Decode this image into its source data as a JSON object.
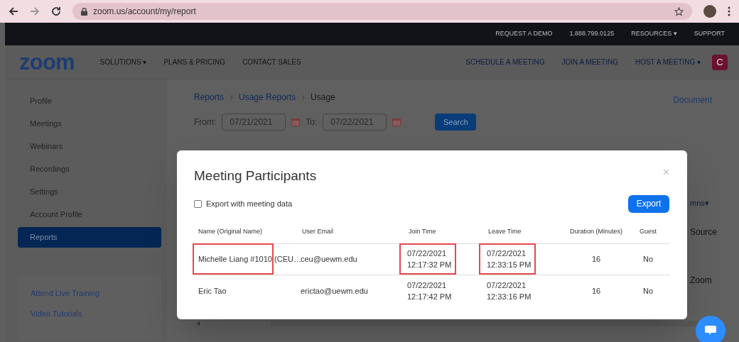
{
  "browser": {
    "url": "zoom.us/account/my/report"
  },
  "top_bar": {
    "links": [
      "REQUEST A DEMO",
      "1.888.799.0125",
      "RESOURCES ▾",
      "SUPPORT"
    ]
  },
  "nav": {
    "logo": "zoom",
    "left_links": [
      "SOLUTIONS ▾",
      "PLANS & PRICING",
      "CONTACT SALES"
    ],
    "right_links": [
      "SCHEDULE A MEETING",
      "JOIN A MEETING",
      "HOST A MEETING ▾"
    ],
    "avatar": "C"
  },
  "sidebar": {
    "items": [
      {
        "label": "Profile",
        "selected": false
      },
      {
        "label": "Meetings",
        "selected": false
      },
      {
        "label": "Webinars",
        "selected": false
      },
      {
        "label": "Recordings",
        "selected": false
      },
      {
        "label": "Settings",
        "selected": false
      },
      {
        "label": "Account Profile",
        "selected": false
      },
      {
        "label": "Reports",
        "selected": true
      }
    ],
    "help_links": [
      "Attend Live Training",
      "Video Tutorials"
    ]
  },
  "breadcrumb": [
    {
      "label": "Reports",
      "link": true
    },
    {
      "label": "Usage Reports",
      "link": true
    },
    {
      "label": "Usage",
      "link": false
    }
  ],
  "document_link": "Document",
  "date_filter": {
    "from_label": "From:",
    "from": "07/21/2021",
    "to_label": "To:",
    "to": "07/22/2021",
    "button": "Search"
  },
  "background_texts": [
    "mns▾",
    "Source",
    "Zoom"
  ],
  "modal": {
    "title": "Meeting Participants",
    "close": "×",
    "export_option": {
      "label": "Export with meeting data",
      "checked": false
    },
    "export_button": "Export",
    "columns": [
      "Name (Original Name)",
      "User Email",
      "Join Time",
      "Leave Time",
      "Duration (Minutes)",
      "Guest"
    ],
    "rows": [
      [
        {
          "text": "Michelle Liang #1010 (CEU…",
          "highlighted": true
        },
        {
          "text": "ceu@uewm.edu",
          "highlighted": false
        },
        {
          "text": "07/22/2021 12:17:32 PM",
          "highlighted": true
        },
        {
          "text": "07/22/2021 12:33:15 PM",
          "highlighted": true
        },
        {
          "text": "16",
          "highlighted": false
        },
        {
          "text": "No",
          "highlighted": false
        }
      ],
      [
        {
          "text": "Eric Tao",
          "highlighted": false
        },
        {
          "text": "erictao@uewm.edu",
          "highlighted": false
        },
        {
          "text": "07/22/2021 12:17:42 PM",
          "highlighted": false
        },
        {
          "text": "07/22/2021 12:33:16 PM",
          "highlighted": false
        },
        {
          "text": "16",
          "highlighted": false
        },
        {
          "text": "No",
          "highlighted": false
        }
      ]
    ]
  }
}
